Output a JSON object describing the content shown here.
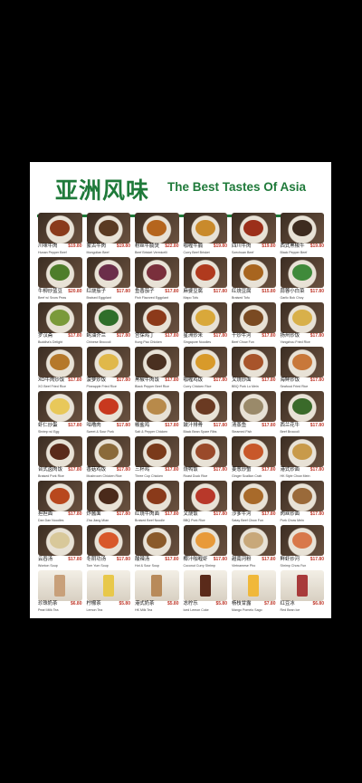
{
  "menu": {
    "title_cn": "亚洲风味",
    "title_en": "The Best Tastes Of Asia",
    "colors": {
      "brand": "#1f7a3a",
      "price": "#c0392b"
    },
    "items": [
      {
        "cn": "川味牛肉",
        "en": "Hunan Pepper Beef",
        "price": "$19.80",
        "color": "#8a3b1c"
      },
      {
        "cn": "蒙古牛肉",
        "en": "Mongolian Beef",
        "price": "$19.80",
        "color": "#5a3a22"
      },
      {
        "cn": "粉丝牛腩煲",
        "en": "Beef Brisket Vermicelli",
        "price": "$22.80",
        "color": "#b5651d"
      },
      {
        "cn": "咖喱牛腩",
        "en": "Curry Beef Brisket",
        "price": "$19.80",
        "color": "#c98a2b"
      },
      {
        "cn": "四川牛肉",
        "en": "Szechuan Beef",
        "price": "$19.80",
        "color": "#9c2f1a"
      },
      {
        "cn": "西式黑椒牛",
        "en": "Black Pepper Beef",
        "price": "$19.80",
        "color": "#3d2b1f"
      },
      {
        "cn": "牛柳炒蓝豆",
        "en": "Beef w/ Snow Peas",
        "price": "$20.80",
        "color": "#4e7d2a"
      },
      {
        "cn": "红烧茄子",
        "en": "Braised Eggplant",
        "price": "$17.80",
        "color": "#6b2e4a"
      },
      {
        "cn": "鱼香茄子",
        "en": "Fish Flavored Eggplant",
        "price": "$17.80",
        "color": "#7a2f3c"
      },
      {
        "cn": "麻婆豆腐",
        "en": "Mapo Tofu",
        "price": "$17.80",
        "color": "#b03a1e"
      },
      {
        "cn": "红烧豆腐",
        "en": "Braised Tofu",
        "price": "$15.80",
        "color": "#a8651f"
      },
      {
        "cn": "蒜蓉小白菜",
        "en": "Garlic Bok Choy",
        "price": "$17.80",
        "color": "#3f8a3a"
      },
      {
        "cn": "罗汉斋",
        "en": "Buddha's Delight",
        "price": "$17.80",
        "color": "#7a9a3a"
      },
      {
        "cn": "蚝油芥兰",
        "en": "Chinese Broccoli",
        "price": "$17.80",
        "color": "#2f6e2a"
      },
      {
        "cn": "宫保鸡丁",
        "en": "Kung Pao Chicken",
        "price": "$17.80",
        "color": "#8c3a1a"
      },
      {
        "cn": "星洲炒米",
        "en": "Singapore Noodles",
        "price": "$17.80",
        "color": "#d9a83a"
      },
      {
        "cn": "干炒牛河",
        "en": "Beef Chow Fun",
        "price": "$17.80",
        "color": "#7a4a22"
      },
      {
        "cn": "扬州炒饭",
        "en": "Yangzhou Fried Rice",
        "price": "$17.80",
        "color": "#d8b04a"
      },
      {
        "cn": "XO牛肉炒饭",
        "en": "XO Beef Fried Rice",
        "price": "$17.80",
        "color": "#b5782a"
      },
      {
        "cn": "菠萝炒饭",
        "en": "Pineapple Fried Rice",
        "price": "$17.80",
        "color": "#e0b84a"
      },
      {
        "cn": "黑椒牛肉饭",
        "en": "Black Pepper Beef Rice",
        "price": "$17.80",
        "color": "#4a3020"
      },
      {
        "cn": "咖喱鸡饭",
        "en": "Curry Chicken Rice",
        "price": "$17.80",
        "color": "#d89a2a"
      },
      {
        "cn": "叉烧炒面",
        "en": "BBQ Pork Lo Mein",
        "price": "$17.80",
        "color": "#a8542a"
      },
      {
        "cn": "海鲜炒饭",
        "en": "Seafood Fried Rice",
        "price": "$17.80",
        "color": "#c8783a"
      },
      {
        "cn": "虾仁炒蛋",
        "en": "Shrimp w/ Egg",
        "price": "$17.80",
        "color": "#e8c85a"
      },
      {
        "cn": "咕噜肉",
        "en": "Sweet & Sour Pork",
        "price": "$17.80",
        "color": "#c8381e"
      },
      {
        "cn": "椒盐鸡",
        "en": "Salt & Pepper Chicken",
        "price": "$17.80",
        "color": "#b88a4a"
      },
      {
        "cn": "豉汁排骨",
        "en": "Black Bean Spare Ribs",
        "price": "$17.80",
        "color": "#6a3a22"
      },
      {
        "cn": "清蒸鱼",
        "en": "Steamed Fish",
        "price": "$17.80",
        "color": "#9a8a6a"
      },
      {
        "cn": "西兰花牛",
        "en": "Beef Broccoli",
        "price": "$17.80",
        "color": "#3a6a2a"
      },
      {
        "cn": "台式卤肉饭",
        "en": "Braised Pork Rice",
        "price": "$17.80",
        "color": "#5a2a1a"
      },
      {
        "cn": "香菇鸡饭",
        "en": "Mushroom Chicken Rice",
        "price": "$17.80",
        "color": "#8a6a3a"
      },
      {
        "cn": "三杯鸡",
        "en": "Three Cup Chicken",
        "price": "$17.80",
        "color": "#7a3a1a"
      },
      {
        "cn": "烧鸭饭",
        "en": "Roast Duck Rice",
        "price": "$17.80",
        "color": "#9a4a2a"
      },
      {
        "cn": "姜葱炒蟹",
        "en": "Ginger Scallion Crab",
        "price": "$17.80",
        "color": "#c8582a"
      },
      {
        "cn": "港式炒面",
        "en": "HK Style Chow Mein",
        "price": "$17.80",
        "color": "#c89a4a"
      },
      {
        "cn": "担担面",
        "en": "Dan Dan Noodles",
        "price": "$17.80",
        "color": "#b8481e"
      },
      {
        "cn": "炸酱面",
        "en": "Zha Jiang Mian",
        "price": "$17.80",
        "color": "#4a2a1a"
      },
      {
        "cn": "红烧牛肉面",
        "en": "Braised Beef Noodle",
        "price": "$17.80",
        "color": "#8a3a1a"
      },
      {
        "cn": "叉烧饭",
        "en": "BBQ Pork Rice",
        "price": "$17.80",
        "color": "#b8382a"
      },
      {
        "cn": "沙爹牛河",
        "en": "Satay Beef Chow Fun",
        "price": "$17.80",
        "color": "#a86a2a"
      },
      {
        "cn": "肉丝炒面",
        "en": "Pork Chow Mein",
        "price": "$17.80",
        "color": "#9a6a3a"
      },
      {
        "cn": "云吞汤",
        "en": "Wonton Soup",
        "price": "$17.80",
        "color": "#d8c89a"
      },
      {
        "cn": "冬阴功汤",
        "en": "Tom Yum Soup",
        "price": "$17.80",
        "color": "#d8582a"
      },
      {
        "cn": "酸辣汤",
        "en": "Hot & Sour Soup",
        "price": "$17.80",
        "color": "#8a5a2a"
      },
      {
        "cn": "椰汁咖喱虾",
        "en": "Coconut Curry Shrimp",
        "price": "$17.80",
        "color": "#e89a3a"
      },
      {
        "cn": "越南河粉",
        "en": "Vietnamese Pho",
        "price": "$17.80",
        "color": "#c8a87a"
      },
      {
        "cn": "鲜虾炒河",
        "en": "Shrimp Chow Fun",
        "price": "$17.80",
        "color": "#d8784a"
      },
      {
        "cn": "珍珠奶茶",
        "en": "Pearl Milk Tea",
        "price": "$6.80",
        "color": "#c8a07a",
        "drink": true
      },
      {
        "cn": "柠檬茶",
        "en": "Lemon Tea",
        "price": "$5.80",
        "color": "#e8c84a",
        "drink": true
      },
      {
        "cn": "港式奶茶",
        "en": "HK Milk Tea",
        "price": "$5.80",
        "color": "#b88a5a",
        "drink": true
      },
      {
        "cn": "冻柠乐",
        "en": "Iced Lemon Coke",
        "price": "$5.80",
        "color": "#5a2a1a",
        "drink": true
      },
      {
        "cn": "杨枝甘露",
        "en": "Mango Pomelo Sago",
        "price": "$7.80",
        "color": "#f0b83a",
        "drink": true
      },
      {
        "cn": "红豆冰",
        "en": "Red Bean Ice",
        "price": "$6.80",
        "color": "#a83a3a",
        "drink": true
      }
    ]
  }
}
